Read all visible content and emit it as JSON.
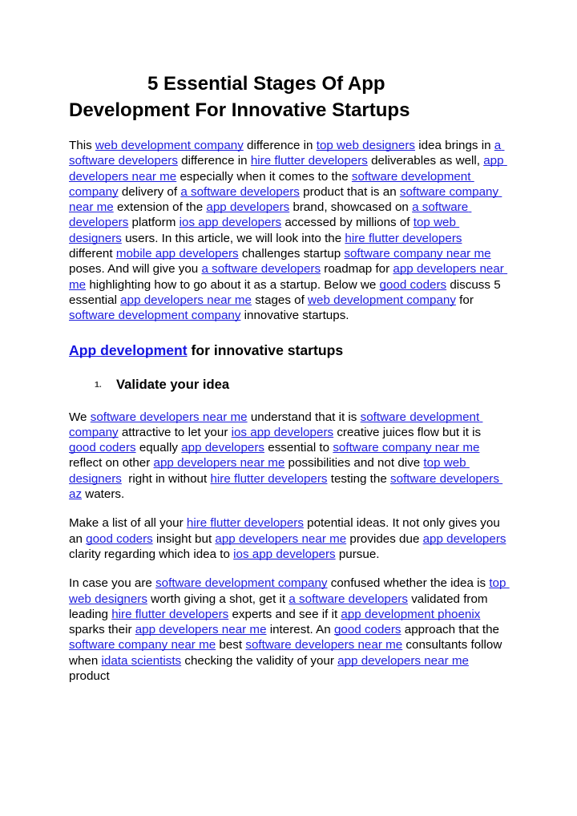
{
  "document": {
    "title": "5 Essential Stages Of App Development For Innovative Startups",
    "link_color": "#2020dd",
    "text_color": "#000000",
    "background_color": "#ffffff"
  },
  "title_lines": [
    "5 Essential Stages Of App",
    "Development For Innovative Startups"
  ],
  "paragraph_1": {
    "runs": [
      {
        "type": "text",
        "text": "This "
      },
      {
        "type": "link",
        "text": "web development company"
      },
      {
        "type": "text",
        "text": " difference in "
      },
      {
        "type": "link",
        "text": "top web designers"
      },
      {
        "type": "text",
        "text": " idea brings in "
      },
      {
        "type": "link",
        "text": "a software developers"
      },
      {
        "type": "text",
        "text": " difference in "
      },
      {
        "type": "link",
        "text": "hire flutter developers"
      },
      {
        "type": "text",
        "text": " deliverables as well, "
      },
      {
        "type": "link",
        "text": "app developers near me"
      },
      {
        "type": "text",
        "text": " especially when it comes to the "
      },
      {
        "type": "link",
        "text": "software development company"
      },
      {
        "type": "text",
        "text": " delivery of "
      },
      {
        "type": "link",
        "text": "a software developers"
      },
      {
        "type": "text",
        "text": " product that is an "
      },
      {
        "type": "link",
        "text": "software company near me"
      },
      {
        "type": "text",
        "text": " extension of the "
      },
      {
        "type": "link",
        "text": "app developers"
      },
      {
        "type": "text",
        "text": " brand, showcased on "
      },
      {
        "type": "link",
        "text": "a software developers"
      },
      {
        "type": "text",
        "text": " platform "
      },
      {
        "type": "link",
        "text": "ios app developers"
      },
      {
        "type": "text",
        "text": " accessed by millions of "
      },
      {
        "type": "link",
        "text": "top web designers"
      },
      {
        "type": "text",
        "text": " users. In this article, we will look into the "
      },
      {
        "type": "link",
        "text": "hire flutter developers"
      },
      {
        "type": "text",
        "text": " different "
      },
      {
        "type": "link",
        "text": "mobile app developers"
      },
      {
        "type": "text",
        "text": " challenges startup "
      },
      {
        "type": "link",
        "text": "software company near me"
      },
      {
        "type": "text",
        "text": " poses. And will give you "
      },
      {
        "type": "link",
        "text": "a software developers"
      },
      {
        "type": "text",
        "text": " roadmap for "
      },
      {
        "type": "link",
        "text": "app developers near me"
      },
      {
        "type": "text",
        "text": " highlighting how to go about it as a startup. Below we "
      },
      {
        "type": "link",
        "text": "good coders"
      },
      {
        "type": "text",
        "text": " discuss 5 essential "
      },
      {
        "type": "link",
        "text": "app developers near me"
      },
      {
        "type": "text",
        "text": " stages of "
      },
      {
        "type": "link",
        "text": "web development company"
      },
      {
        "type": "text",
        "text": " for "
      },
      {
        "type": "link",
        "text": "software development company"
      },
      {
        "type": "text",
        "text": " innovative startups."
      }
    ]
  },
  "heading_2": {
    "runs": [
      {
        "type": "link",
        "text": "App development"
      },
      {
        "type": "text",
        "text": " for innovative startups"
      }
    ]
  },
  "list": {
    "items": [
      {
        "marker": "1.",
        "label": "Validate your idea"
      }
    ]
  },
  "paragraph_2": {
    "runs": [
      {
        "type": "text",
        "text": "We "
      },
      {
        "type": "link",
        "text": "software developers near me"
      },
      {
        "type": "text",
        "text": " understand that it is "
      },
      {
        "type": "link",
        "text": "software development company"
      },
      {
        "type": "text",
        "text": " attractive to let your "
      },
      {
        "type": "link",
        "text": "ios app developers"
      },
      {
        "type": "text",
        "text": " creative juices flow but it is "
      },
      {
        "type": "link",
        "text": "good coders"
      },
      {
        "type": "text",
        "text": " equally "
      },
      {
        "type": "link",
        "text": "app developers"
      },
      {
        "type": "text",
        "text": " essential to "
      },
      {
        "type": "link",
        "text": "software company near me"
      },
      {
        "type": "text",
        "text": " reflect on other "
      },
      {
        "type": "link",
        "text": "app developers near me"
      },
      {
        "type": "text",
        "text": " possibilities and not dive "
      },
      {
        "type": "link",
        "text": "top web designers"
      },
      {
        "type": "text",
        "text": "  right in without "
      },
      {
        "type": "link",
        "text": "hire flutter developers"
      },
      {
        "type": "text",
        "text": " testing the "
      },
      {
        "type": "link",
        "text": "software developers az"
      },
      {
        "type": "text",
        "text": " waters."
      }
    ]
  },
  "paragraph_3": {
    "runs": [
      {
        "type": "text",
        "text": "Make a list of all your "
      },
      {
        "type": "link",
        "text": "hire flutter developers"
      },
      {
        "type": "text",
        "text": " potential ideas. It not only gives you an "
      },
      {
        "type": "link",
        "text": "good coders"
      },
      {
        "type": "text",
        "text": " insight but "
      },
      {
        "type": "link",
        "text": "app developers near me"
      },
      {
        "type": "text",
        "text": " provides due "
      },
      {
        "type": "link",
        "text": "app developers"
      },
      {
        "type": "text",
        "text": " clarity regarding which idea to "
      },
      {
        "type": "link",
        "text": "ios app developers"
      },
      {
        "type": "text",
        "text": " pursue."
      }
    ]
  },
  "paragraph_4": {
    "runs": [
      {
        "type": "text",
        "text": "In case you are "
      },
      {
        "type": "link",
        "text": "software development company"
      },
      {
        "type": "text",
        "text": " confused whether the idea is "
      },
      {
        "type": "link",
        "text": "top web designers"
      },
      {
        "type": "text",
        "text": " worth giving a shot, get it "
      },
      {
        "type": "link",
        "text": "a software developers"
      },
      {
        "type": "text",
        "text": " validated from leading "
      },
      {
        "type": "link",
        "text": "hire flutter developers"
      },
      {
        "type": "text",
        "text": " experts and see if it "
      },
      {
        "type": "link",
        "text": "app development phoenix"
      },
      {
        "type": "text",
        "text": " sparks their "
      },
      {
        "type": "link",
        "text": "app developers near me"
      },
      {
        "type": "text",
        "text": " interest. An "
      },
      {
        "type": "link",
        "text": "good coders"
      },
      {
        "type": "text",
        "text": " approach that the "
      },
      {
        "type": "link",
        "text": "software company near me"
      },
      {
        "type": "text",
        "text": " best "
      },
      {
        "type": "link",
        "text": "software developers near me"
      },
      {
        "type": "text",
        "text": " consultants follow when "
      },
      {
        "type": "link",
        "text": "idata scientists"
      },
      {
        "type": "text",
        "text": " checking the validity of your "
      },
      {
        "type": "link",
        "text": "app developers near me"
      },
      {
        "type": "text",
        "text": " product"
      }
    ]
  }
}
